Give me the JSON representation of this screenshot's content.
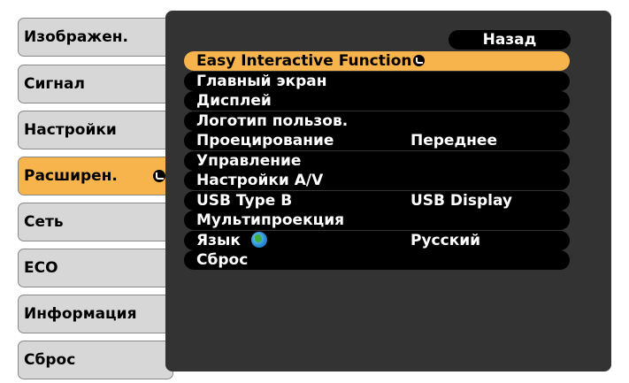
{
  "sidebar": {
    "items": [
      {
        "label": "Изображен."
      },
      {
        "label": "Сигнал"
      },
      {
        "label": "Настройки"
      },
      {
        "label": "Расширен."
      },
      {
        "label": "Сеть"
      },
      {
        "label": "ECO"
      },
      {
        "label": "Информация"
      },
      {
        "label": "Сброс"
      }
    ],
    "active_index": 3
  },
  "panel": {
    "back_label": "Назад",
    "items": [
      {
        "label": "Easy Interactive Function",
        "value": ""
      },
      {
        "label": "Главный экран",
        "value": ""
      },
      {
        "label": "Дисплей",
        "value": ""
      },
      {
        "label": "Логотип пользов.",
        "value": ""
      },
      {
        "label": "Проецирование",
        "value": "Переднее"
      },
      {
        "label": "Управление",
        "value": ""
      },
      {
        "label": "Настройки A/V",
        "value": ""
      },
      {
        "label": "USB Type B",
        "value": "USB Display"
      },
      {
        "label": "Мультипроекция",
        "value": ""
      },
      {
        "label": "Язык",
        "value": "Русский"
      },
      {
        "label": "Сброс",
        "value": ""
      }
    ],
    "active_index": 0
  },
  "colors": {
    "accent": "#f7b44d",
    "sidebar_button": "#d7d7d7",
    "panel_background": "#333333",
    "row_background": "#000000"
  },
  "icons": [
    "enter-icon",
    "globe-icon"
  ]
}
